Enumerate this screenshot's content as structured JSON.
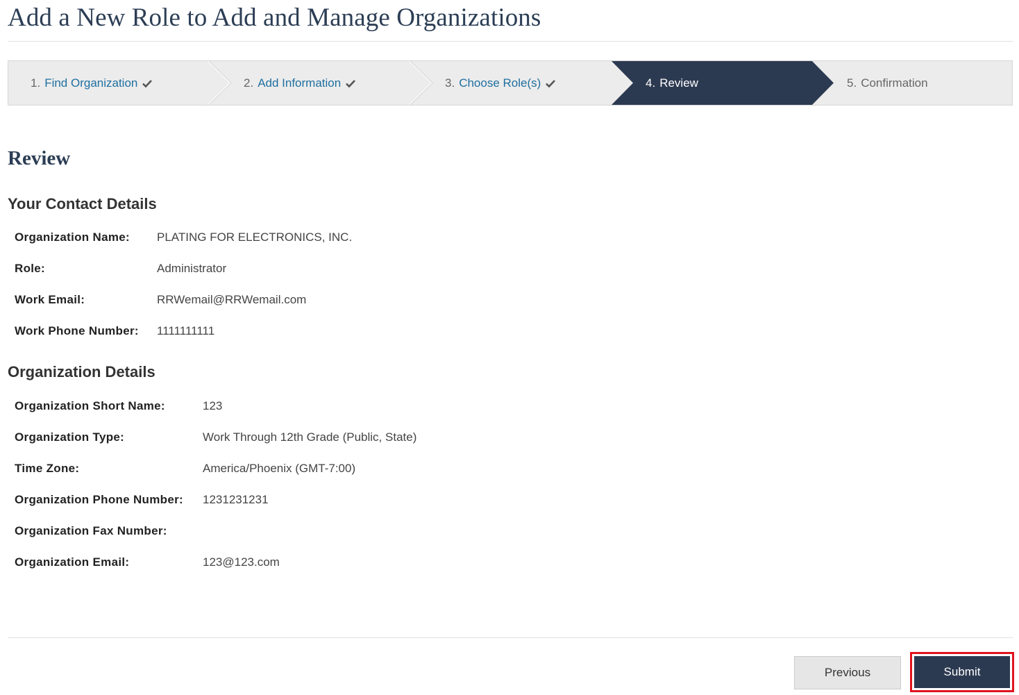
{
  "page": {
    "title": "Add a New Role to Add and Manage Organizations"
  },
  "steps": [
    {
      "num": "1.",
      "label": "Find Organization",
      "state": "complete"
    },
    {
      "num": "2.",
      "label": "Add Information",
      "state": "complete"
    },
    {
      "num": "3.",
      "label": "Choose Role(s)",
      "state": "complete"
    },
    {
      "num": "4.",
      "label": "Review",
      "state": "active"
    },
    {
      "num": "5.",
      "label": "Confirmation",
      "state": "future"
    }
  ],
  "review": {
    "title": "Review",
    "contact": {
      "heading": "Your Contact Details",
      "fields": [
        {
          "label": "Organization Name:",
          "value": "PLATING FOR ELECTRONICS, INC."
        },
        {
          "label": "Role:",
          "value": "Administrator"
        },
        {
          "label": "Work Email:",
          "value": "RRWemail@RRWemail.com"
        },
        {
          "label": "Work Phone Number:",
          "value": "1111111111"
        }
      ]
    },
    "organization": {
      "heading": "Organization Details",
      "fields": [
        {
          "label": "Organization Short Name:",
          "value": "123"
        },
        {
          "label": "Organization Type:",
          "value": "Work Through 12th Grade (Public, State)"
        },
        {
          "label": "Time Zone:",
          "value": "America/Phoenix (GMT-7:00)"
        },
        {
          "label": "Organization Phone Number:",
          "value": "1231231231"
        },
        {
          "label": "Organization Fax Number:",
          "value": ""
        },
        {
          "label": "Organization Email:",
          "value": "123@123.com"
        }
      ]
    }
  },
  "buttons": {
    "previous": "Previous",
    "submit": "Submit"
  },
  "colors": {
    "active_step": "#2c3a51",
    "step_bg": "#ececec",
    "link": "#1f6fa0",
    "highlight_border": "#e0141e"
  },
  "icons": {
    "step_complete": "checkmark-icon"
  }
}
